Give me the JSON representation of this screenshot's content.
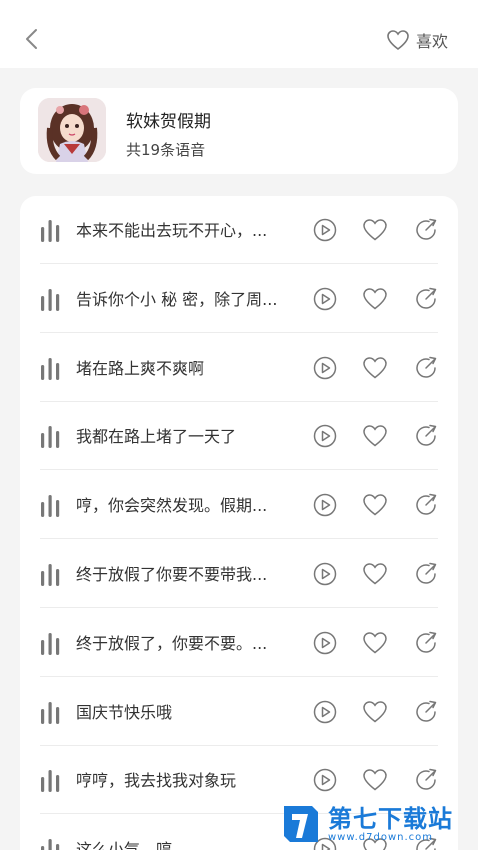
{
  "header": {
    "back_icon": "chevron-left-icon",
    "like_icon": "heart-outline-icon",
    "like_label": "喜欢"
  },
  "album": {
    "title": "软妹贺假期",
    "count": "共19条语音",
    "avatar_icon": "anime-girl-avatar"
  },
  "items": [
    {
      "text": "本来不能出去玩不开心，..."
    },
    {
      "text": "告诉你个小 秘 密，除了周..."
    },
    {
      "text": "堵在路上爽不爽啊"
    },
    {
      "text": "我都在路上堵了一天了"
    },
    {
      "text": "哼，你会突然发现。假期..."
    },
    {
      "text": "终于放假了你要不要带我..."
    },
    {
      "text": "终于放假了，你要不要。..."
    },
    {
      "text": "国庆节快乐哦"
    },
    {
      "text": "哼哼，我去找我对象玩"
    },
    {
      "text": "这么小气，哼"
    }
  ],
  "row_icons": {
    "bars": "audio-bars-icon",
    "play": "play-icon",
    "like": "heart-outline-icon",
    "share": "share-icon"
  },
  "watermark": {
    "main": "第七下载站",
    "sub": "www.d7down.com"
  },
  "colors": {
    "background": "#f4f4f4",
    "card": "#ffffff",
    "icon_gray": "#777777",
    "watermark_blue": "#1a7ad8"
  }
}
